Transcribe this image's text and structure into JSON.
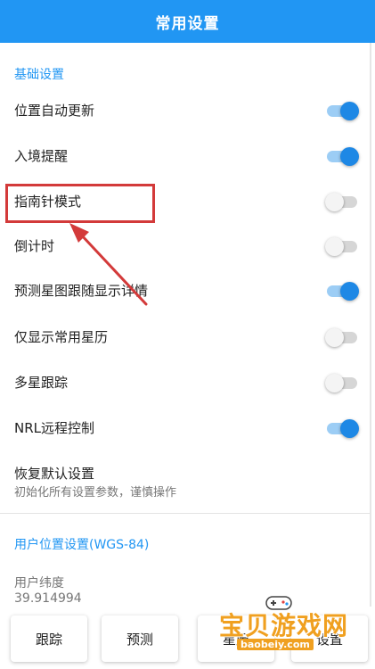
{
  "header": {
    "title": "常用设置"
  },
  "basic": {
    "section_title": "基础设置",
    "items": [
      {
        "label": "位置自动更新",
        "on": true
      },
      {
        "label": "入境提醒",
        "on": true
      },
      {
        "label": "指南针模式",
        "on": false
      },
      {
        "label": "倒计时",
        "on": false
      },
      {
        "label": "预测星图跟随显示详情",
        "on": true
      },
      {
        "label": "仅显示常用星历",
        "on": false
      },
      {
        "label": "多星跟踪",
        "on": false
      },
      {
        "label": "NRL远程控制",
        "on": true
      }
    ],
    "reset": {
      "title": "恢复默认设置",
      "subtitle": "初始化所有设置参数，谨慎操作"
    }
  },
  "user_location": {
    "section_title": "用户位置设置(WGS-84)",
    "latitude_label": "用户纬度",
    "latitude_value": "39.914994"
  },
  "bottom_bar": {
    "buttons": [
      "跟踪",
      "预测",
      "星历",
      "设置"
    ]
  },
  "watermark": {
    "text": "宝贝游戏网",
    "url": "baobeiy.com"
  },
  "colors": {
    "accent": "#2196f3",
    "toggle_on": "#1e88e5",
    "annotation": "#d33a3a",
    "watermark": "#f0a020"
  }
}
